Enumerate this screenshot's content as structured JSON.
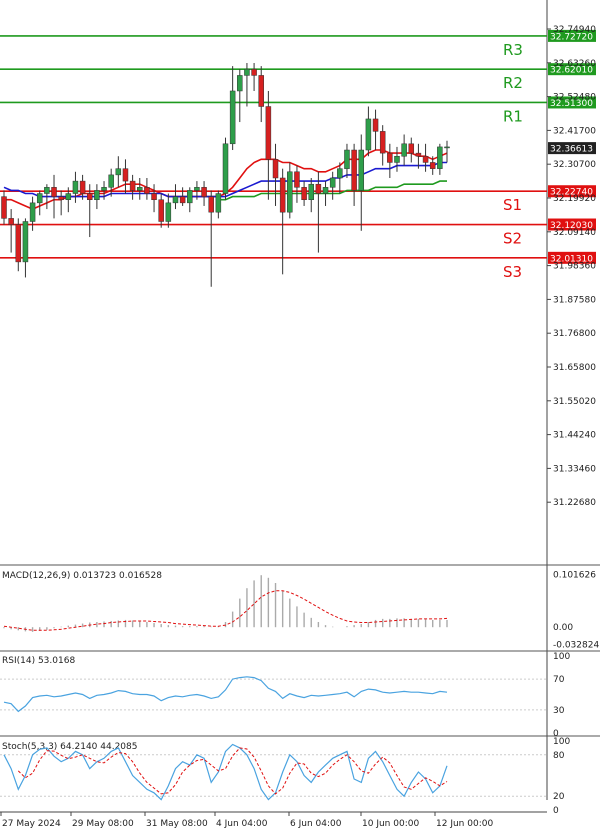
{
  "chart_data": {
    "type": "candlestick",
    "price_axis": {
      "min": 31.2,
      "max": 32.75,
      "ticks": [
        "32.74940",
        "32.63260",
        "32.52480",
        "32.41700",
        "32.30700",
        "32.19920",
        "32.09140",
        "31.98360",
        "31.87580",
        "31.76800",
        "31.65800",
        "31.55020",
        "31.44240",
        "31.33460",
        "31.22680"
      ]
    },
    "current_price": "32.36613",
    "levels": [
      {
        "name": "R3",
        "value": 32.7272,
        "label": "32.72720",
        "color": "#1f9a1f"
      },
      {
        "name": "R2",
        "value": 32.6201,
        "label": "32.62010",
        "color": "#1f9a1f"
      },
      {
        "name": "R1",
        "value": 32.513,
        "label": "32.51300",
        "color": "#1f9a1f"
      },
      {
        "name": "S1",
        "value": 32.2274,
        "label": "32.22740",
        "color": "#e01010"
      },
      {
        "name": "S2",
        "value": 32.1203,
        "label": "32.12030",
        "color": "#e01010"
      },
      {
        "name": "S3",
        "value": 32.0131,
        "label": "32.01310",
        "color": "#e01010"
      }
    ],
    "x_labels": [
      "27 May 2024",
      "29 May 08:00",
      "31 May 08:00",
      "4 Jun 04:00",
      "6 Jun 04:00",
      "10 Jun 00:00",
      "12 Jun 00:00"
    ],
    "candles": [
      [
        32.21,
        32.23,
        32.12,
        32.14
      ],
      [
        32.14,
        32.17,
        32.03,
        32.12
      ],
      [
        32.12,
        32.14,
        31.97,
        32.0
      ],
      [
        32.0,
        32.14,
        31.95,
        32.13
      ],
      [
        32.13,
        32.21,
        32.1,
        32.19
      ],
      [
        32.19,
        32.23,
        32.15,
        32.22
      ],
      [
        32.22,
        32.25,
        32.17,
        32.24
      ],
      [
        32.24,
        32.28,
        32.14,
        32.21
      ],
      [
        32.21,
        32.23,
        32.15,
        32.2
      ],
      [
        32.2,
        32.24,
        32.16,
        32.22
      ],
      [
        32.22,
        32.29,
        32.19,
        32.26
      ],
      [
        32.26,
        32.28,
        32.2,
        32.22
      ],
      [
        32.22,
        32.25,
        32.08,
        32.2
      ],
      [
        32.2,
        32.25,
        32.17,
        32.23
      ],
      [
        32.23,
        32.26,
        32.2,
        32.24
      ],
      [
        32.24,
        32.3,
        32.21,
        32.28
      ],
      [
        32.28,
        32.34,
        32.24,
        32.3
      ],
      [
        32.3,
        32.33,
        32.22,
        32.26
      ],
      [
        32.26,
        32.28,
        32.2,
        32.23
      ],
      [
        32.23,
        32.27,
        32.2,
        32.24
      ],
      [
        32.24,
        32.27,
        32.2,
        32.22
      ],
      [
        32.22,
        32.25,
        32.16,
        32.2
      ],
      [
        32.2,
        32.22,
        32.11,
        32.13
      ],
      [
        32.13,
        32.22,
        32.11,
        32.19
      ],
      [
        32.19,
        32.25,
        32.17,
        32.21
      ],
      [
        32.21,
        32.24,
        32.18,
        32.19
      ],
      [
        32.19,
        32.24,
        32.16,
        32.23
      ],
      [
        32.23,
        32.26,
        32.2,
        32.24
      ],
      [
        32.24,
        32.26,
        32.18,
        32.21
      ],
      [
        32.21,
        32.23,
        31.92,
        32.16
      ],
      [
        32.16,
        32.23,
        32.14,
        32.22
      ],
      [
        32.22,
        32.4,
        32.2,
        32.38
      ],
      [
        32.38,
        32.63,
        32.36,
        32.55
      ],
      [
        32.55,
        32.62,
        32.45,
        32.6
      ],
      [
        32.6,
        32.64,
        32.5,
        32.62
      ],
      [
        32.62,
        32.64,
        32.55,
        32.6
      ],
      [
        32.6,
        32.63,
        32.45,
        32.5
      ],
      [
        32.5,
        32.55,
        32.2,
        32.33
      ],
      [
        32.33,
        32.38,
        32.18,
        32.27
      ],
      [
        32.27,
        32.3,
        31.96,
        32.16
      ],
      [
        32.16,
        32.32,
        32.14,
        32.29
      ],
      [
        32.29,
        32.31,
        32.19,
        32.24
      ],
      [
        32.24,
        32.26,
        32.18,
        32.2
      ],
      [
        32.2,
        32.27,
        32.16,
        32.25
      ],
      [
        32.25,
        32.29,
        32.03,
        32.22
      ],
      [
        32.22,
        32.26,
        32.18,
        32.24
      ],
      [
        32.24,
        32.29,
        32.2,
        32.27
      ],
      [
        32.27,
        32.32,
        32.22,
        32.3
      ],
      [
        32.3,
        32.38,
        32.27,
        32.36
      ],
      [
        32.36,
        32.38,
        32.18,
        32.23
      ],
      [
        32.23,
        32.41,
        32.1,
        32.36
      ],
      [
        32.36,
        32.5,
        32.34,
        32.46
      ],
      [
        32.46,
        32.49,
        32.36,
        32.42
      ],
      [
        32.42,
        32.44,
        32.31,
        32.35
      ],
      [
        32.35,
        32.38,
        32.27,
        32.32
      ],
      [
        32.32,
        32.37,
        32.29,
        32.34
      ],
      [
        32.34,
        32.41,
        32.31,
        32.38
      ],
      [
        32.38,
        32.4,
        32.32,
        32.35
      ],
      [
        32.35,
        32.38,
        32.3,
        32.34
      ],
      [
        32.34,
        32.38,
        32.29,
        32.32
      ],
      [
        32.32,
        32.34,
        32.28,
        32.3
      ],
      [
        32.3,
        32.38,
        32.28,
        32.37
      ],
      [
        32.37,
        32.39,
        32.32,
        32.37
      ]
    ],
    "moving_averages": [
      {
        "color": "#e01010",
        "values": [
          32.2,
          32.2,
          32.19,
          32.18,
          32.17,
          32.18,
          32.19,
          32.2,
          32.2,
          32.21,
          32.21,
          32.22,
          32.22,
          32.22,
          32.22,
          32.23,
          32.24,
          32.25,
          32.25,
          32.25,
          32.24,
          32.23,
          32.22,
          32.21,
          32.21,
          32.21,
          32.21,
          32.21,
          32.21,
          32.21,
          32.21,
          32.22,
          32.24,
          32.27,
          32.3,
          32.32,
          32.33,
          32.33,
          32.33,
          32.32,
          32.32,
          32.31,
          32.3,
          32.3,
          32.29,
          32.29,
          32.3,
          32.31,
          32.33,
          32.33,
          32.33,
          32.35,
          32.36,
          32.36,
          32.35,
          32.35,
          32.35,
          32.35,
          32.34,
          32.34,
          32.33,
          32.34,
          32.35
        ]
      },
      {
        "color": "#1a1ad0",
        "values": [
          32.24,
          32.23,
          32.23,
          32.22,
          32.22,
          32.21,
          32.21,
          32.21,
          32.21,
          32.21,
          32.21,
          32.21,
          32.21,
          32.21,
          32.21,
          32.22,
          32.22,
          32.22,
          32.22,
          32.22,
          32.22,
          32.22,
          32.22,
          32.21,
          32.21,
          32.21,
          32.21,
          32.21,
          32.21,
          32.21,
          32.21,
          32.21,
          32.22,
          32.23,
          32.24,
          32.25,
          32.26,
          32.26,
          32.26,
          32.26,
          32.26,
          32.26,
          32.26,
          32.26,
          32.26,
          32.26,
          32.27,
          32.27,
          32.28,
          32.28,
          32.28,
          32.29,
          32.3,
          32.3,
          32.3,
          32.31,
          32.31,
          32.31,
          32.31,
          32.31,
          32.31,
          32.32,
          32.32
        ]
      },
      {
        "color": "#1f9a1f",
        "values": [
          null,
          null,
          null,
          null,
          null,
          null,
          null,
          null,
          null,
          null,
          null,
          null,
          null,
          null,
          null,
          null,
          null,
          null,
          null,
          null,
          null,
          null,
          null,
          null,
          null,
          null,
          null,
          null,
          null,
          null,
          32.2,
          32.2,
          32.21,
          32.21,
          32.21,
          32.21,
          32.22,
          32.22,
          32.22,
          32.22,
          32.22,
          32.22,
          32.22,
          32.22,
          32.22,
          32.22,
          32.22,
          32.22,
          32.23,
          32.23,
          32.23,
          32.23,
          32.24,
          32.24,
          32.24,
          32.24,
          32.25,
          32.25,
          32.25,
          32.25,
          32.25,
          32.26,
          32.26
        ]
      }
    ],
    "macd": {
      "label": "MACD(12,26,9) 0.013723 0.016528",
      "axis": {
        "min": -0.04,
        "max": 0.11,
        "ticks": [
          "0.101626",
          "0.00",
          "-0.032824"
        ]
      },
      "histogram": [
        -0.002,
        -0.004,
        -0.006,
        -0.008,
        -0.009,
        -0.007,
        -0.005,
        -0.002,
        0.001,
        0.003,
        0.005,
        0.007,
        0.009,
        0.01,
        0.011,
        0.012,
        0.013,
        0.014,
        0.013,
        0.012,
        0.01,
        0.008,
        0.006,
        0.004,
        0.003,
        0.002,
        0.002,
        0.002,
        0.002,
        0.001,
        0.002,
        0.01,
        0.03,
        0.055,
        0.075,
        0.09,
        0.1,
        0.095,
        0.085,
        0.07,
        0.055,
        0.04,
        0.028,
        0.018,
        0.01,
        0.004,
        0.001,
        0.0,
        0.002,
        0.004,
        0.006,
        0.01,
        0.014,
        0.016,
        0.016,
        0.017,
        0.017,
        0.016,
        0.016,
        0.015,
        0.014,
        0.014,
        0.014
      ],
      "signal": [
        0.002,
        0.0,
        -0.002,
        -0.004,
        -0.006,
        -0.006,
        -0.006,
        -0.005,
        -0.004,
        -0.002,
        0.0,
        0.002,
        0.004,
        0.006,
        0.007,
        0.009,
        0.01,
        0.011,
        0.012,
        0.012,
        0.012,
        0.011,
        0.01,
        0.009,
        0.007,
        0.006,
        0.005,
        0.004,
        0.003,
        0.002,
        0.002,
        0.004,
        0.01,
        0.02,
        0.032,
        0.045,
        0.058,
        0.066,
        0.07,
        0.07,
        0.067,
        0.061,
        0.054,
        0.046,
        0.038,
        0.03,
        0.023,
        0.017,
        0.012,
        0.01,
        0.009,
        0.009,
        0.01,
        0.011,
        0.012,
        0.013,
        0.014,
        0.015,
        0.016,
        0.016,
        0.016,
        0.016,
        0.017
      ]
    },
    "rsi": {
      "label": "RSI(14) 53.0168",
      "axis": {
        "min": 0,
        "max": 100,
        "ticks": [
          "100",
          "70",
          "30",
          "0"
        ]
      },
      "values": [
        40,
        38,
        28,
        35,
        46,
        48,
        49,
        47,
        48,
        50,
        52,
        50,
        45,
        49,
        50,
        52,
        55,
        54,
        51,
        50,
        50,
        48,
        42,
        46,
        48,
        47,
        49,
        50,
        48,
        45,
        47,
        56,
        70,
        72,
        73,
        72,
        68,
        58,
        54,
        45,
        51,
        48,
        46,
        49,
        48,
        49,
        50,
        51,
        53,
        47,
        54,
        57,
        56,
        53,
        52,
        53,
        54,
        53,
        53,
        52,
        51,
        54,
        53
      ]
    },
    "stoch": {
      "label": "Stoch(5,3,3) 64.2140 44.2085",
      "axis": {
        "min": 0,
        "max": 100,
        "ticks": [
          "100",
          "80",
          "20",
          "0"
        ]
      },
      "k": [
        80,
        60,
        30,
        50,
        80,
        88,
        90,
        78,
        70,
        75,
        85,
        80,
        60,
        70,
        75,
        85,
        90,
        70,
        50,
        40,
        30,
        25,
        15,
        35,
        60,
        70,
        65,
        80,
        75,
        40,
        55,
        85,
        95,
        90,
        80,
        60,
        30,
        15,
        25,
        55,
        80,
        70,
        50,
        40,
        55,
        65,
        75,
        80,
        85,
        45,
        40,
        75,
        85,
        70,
        50,
        30,
        20,
        40,
        55,
        45,
        25,
        35,
        64
      ]
    }
  }
}
